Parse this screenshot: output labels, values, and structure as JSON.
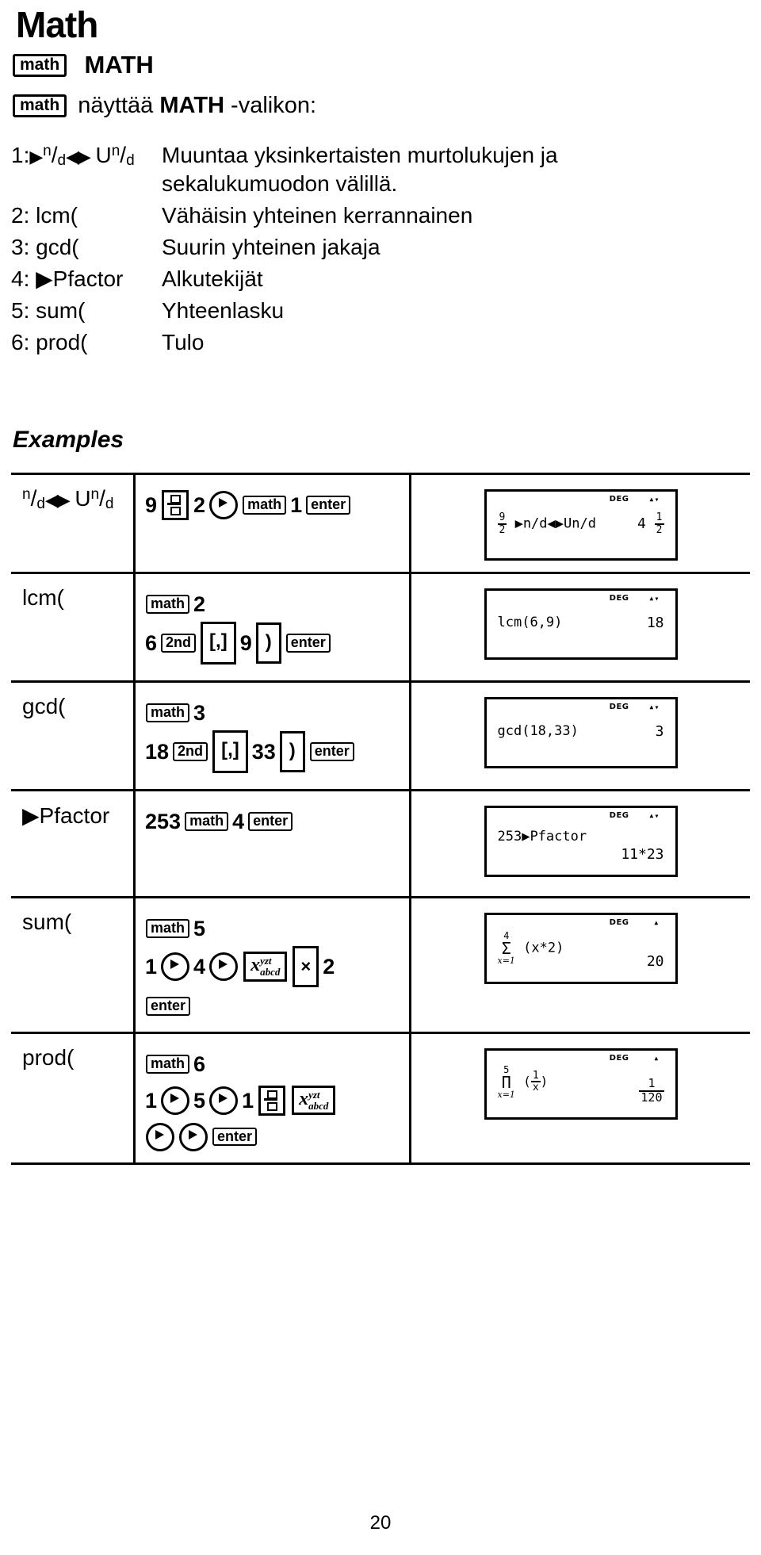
{
  "page": {
    "title": "Math",
    "page_number": "20"
  },
  "intro": {
    "key_label": "math",
    "heading": "MATH",
    "sentence_pre": "näyttää ",
    "sentence_bold": "MATH",
    "sentence_post": " -valikon:"
  },
  "menu": {
    "items": [
      {
        "num": "1:",
        "key_type": "frac-convert",
        "key": "▶n/d◀▶ Un/d",
        "desc": "Muuntaa yksinkertaisten murtolukujen ja sekalukumuodon välillä."
      },
      {
        "num": "2:",
        "key_type": "text",
        "key": "lcm(",
        "desc": "Vähäisin yhteinen kerrannainen"
      },
      {
        "num": "3:",
        "key_type": "text",
        "key": "gcd(",
        "desc": "Suurin yhteinen jakaja"
      },
      {
        "num": "4:",
        "key_type": "arrow-text",
        "key": "▶Pfactor",
        "desc": "Alkutekijät"
      },
      {
        "num": "5:",
        "key_type": "text",
        "key": "sum(",
        "desc": "Yhteenlasku"
      },
      {
        "num": "6:",
        "key_type": "text",
        "key": "prod(",
        "desc": "Tulo"
      }
    ]
  },
  "examples": {
    "heading": "Examples",
    "rows": [
      {
        "name": "n/d◀▶ Un/d",
        "keys_line1": [
          "9",
          "frac-key",
          "2",
          "right-arrow-key",
          "math",
          "1",
          "enter"
        ],
        "keys_line2": [],
        "screen": {
          "mode": "DEG",
          "indicator": "up-down",
          "expr_numerator": "9",
          "expr_denominator": "2",
          "expr_suffix": "▶n/d◀▶Un/d",
          "result_whole": "4",
          "result_numerator": "1",
          "result_denominator": "2"
        }
      },
      {
        "name": "lcm(",
        "keys_line1": [
          "math",
          "2"
        ],
        "keys_line2": [
          "6",
          "2nd",
          "[,]",
          "9",
          ")",
          "enter"
        ],
        "screen": {
          "mode": "DEG",
          "indicator": "up-down",
          "expr": "lcm(6,9)",
          "result": "18"
        }
      },
      {
        "name": "gcd(",
        "keys_line1": [
          "math",
          "3"
        ],
        "keys_line2": [
          "18",
          "2nd",
          "[,]",
          "33",
          ")",
          "enter"
        ],
        "screen": {
          "mode": "DEG",
          "indicator": "up-down",
          "expr": "gcd(18,33)",
          "result": "3"
        }
      },
      {
        "name": "▶Pfactor",
        "keys_line1": [
          "253",
          "math",
          "4",
          "enter"
        ],
        "keys_line2": [],
        "screen": {
          "mode": "DEG",
          "indicator": "up-down",
          "expr": "253▶Pfactor",
          "result": "11*23"
        }
      },
      {
        "name": "sum(",
        "keys_line1": [
          "math",
          "5"
        ],
        "keys_line2": [
          "1",
          "right-arrow-key",
          "4",
          "right-arrow-key",
          "var-key",
          "×",
          "2"
        ],
        "keys_line3": [
          "enter"
        ],
        "screen": {
          "mode": "DEG",
          "indicator": "up",
          "sigma_top": "4",
          "sigma_symbol": "Σ",
          "sigma_bottom": "x=1",
          "expr": "(x*2)",
          "result": "20"
        }
      },
      {
        "name": "prod(",
        "keys_line1": [
          "math",
          "6"
        ],
        "keys_line2": [
          "1",
          "right-arrow-key",
          "5",
          "right-arrow-key",
          "1",
          "frac-key",
          "var-key"
        ],
        "keys_line3": [
          "right-arrow-key",
          "right-arrow-key",
          "enter"
        ],
        "screen": {
          "mode": "DEG",
          "indicator": "up",
          "sigma_top": "5",
          "sigma_symbol": "Π",
          "sigma_bottom": "x=1",
          "expr_open": "(",
          "expr_numerator": "1",
          "expr_denominator": "x",
          "expr_close": ")",
          "result_numerator": "1",
          "result_denominator": "120"
        }
      }
    ]
  },
  "labels": {
    "math_key": "math",
    "enter_key": "enter",
    "second_key": "2nd",
    "comma_key": ",",
    "paren_key": ")",
    "mult_key": "×"
  }
}
